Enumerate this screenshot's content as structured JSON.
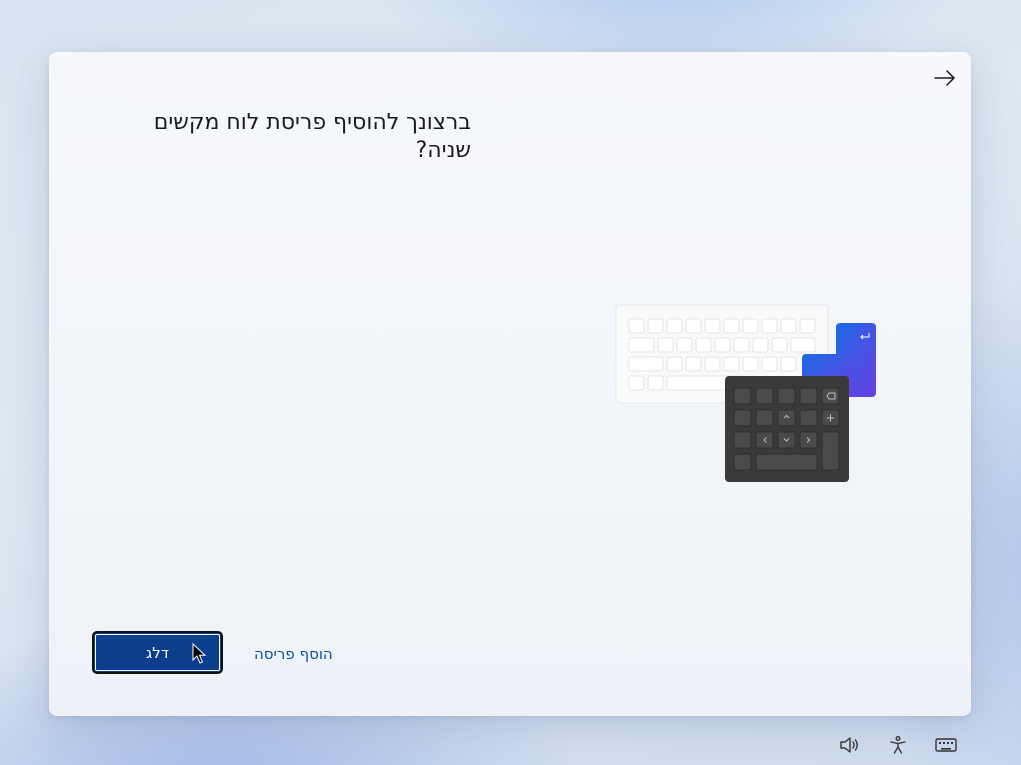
{
  "dialog": {
    "title": "ברצונך להוסיף פריסת לוח מקשים שניה?",
    "back_icon": "arrow-back-icon",
    "illustration": "keyboard-layout-illustration"
  },
  "actions": {
    "skip_label": "דלג",
    "add_layout_label": "הוסף פריסה"
  },
  "taskbar": {
    "icons": [
      "volume-icon",
      "accessibility-icon",
      "keyboard-icon"
    ]
  },
  "colors": {
    "primary_button": "#0b3e8c",
    "link": "#0b4f9c",
    "accent_key_blue": "#1e5ae0",
    "accent_key_purple": "#6a3fe0",
    "numpad": "#3a3a3a"
  }
}
